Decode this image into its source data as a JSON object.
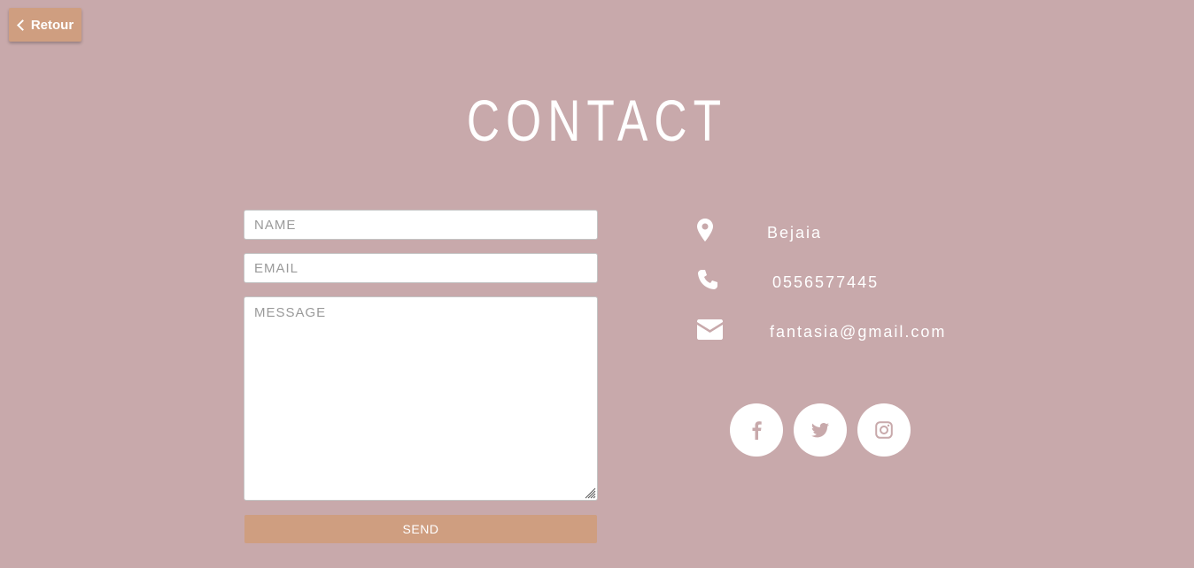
{
  "back_button": {
    "label": "Retour"
  },
  "page_title": "CONTACT",
  "form": {
    "name_placeholder": "NAME",
    "email_placeholder": "EMAIL",
    "message_placeholder": "MESSAGE",
    "send_label": "SEND"
  },
  "contact_info": {
    "location": "Bejaia",
    "phone": "0556577445",
    "email": "fantasia@gmail.com"
  },
  "social": [
    {
      "icon": "facebook-icon"
    },
    {
      "icon": "twitter-icon"
    },
    {
      "icon": "instagram-icon"
    }
  ],
  "colors": {
    "background": "#c8a9ab",
    "accent": "#cf9e80",
    "text": "#ffffff",
    "social_icon": "#c8a9ab"
  }
}
